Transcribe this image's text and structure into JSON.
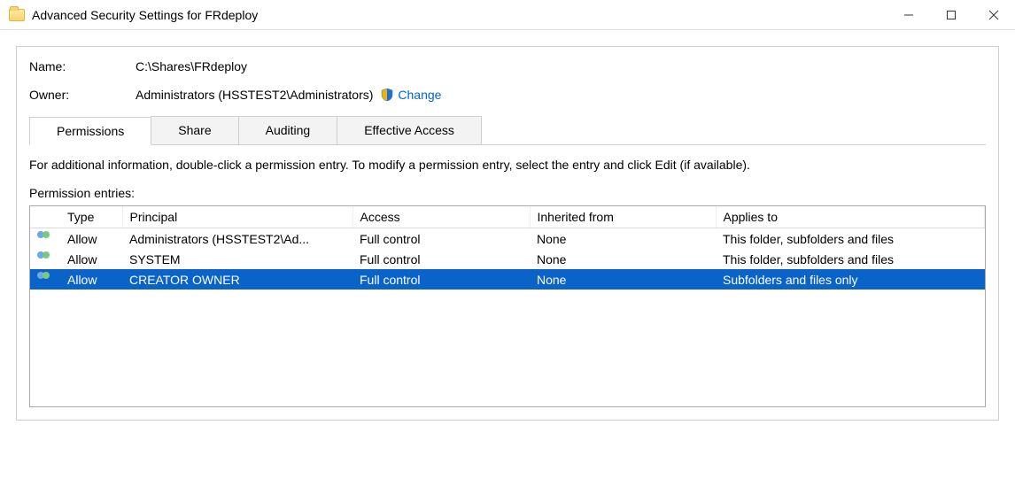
{
  "window": {
    "title": "Advanced Security Settings for FRdeploy"
  },
  "fields": {
    "name_label": "Name:",
    "name_value": "C:\\Shares\\FRdeploy",
    "owner_label": "Owner:",
    "owner_value": "Administrators (HSSTEST2\\Administrators)",
    "change_link": "Change"
  },
  "tabs": {
    "permissions": "Permissions",
    "share": "Share",
    "auditing": "Auditing",
    "effective": "Effective Access",
    "active": "permissions"
  },
  "permissions_tab": {
    "info": "For additional information, double-click a permission entry. To modify a permission entry, select the entry and click Edit (if available).",
    "entries_label": "Permission entries:",
    "columns": {
      "type": "Type",
      "principal": "Principal",
      "access": "Access",
      "inherited": "Inherited from",
      "applies": "Applies to"
    },
    "rows": [
      {
        "type": "Allow",
        "principal": "Administrators (HSSTEST2\\Ad...",
        "access": "Full control",
        "inherited": "None",
        "applies": "This folder, subfolders and files",
        "selected": false
      },
      {
        "type": "Allow",
        "principal": "SYSTEM",
        "access": "Full control",
        "inherited": "None",
        "applies": "This folder, subfolders and files",
        "selected": false
      },
      {
        "type": "Allow",
        "principal": "CREATOR OWNER",
        "access": "Full control",
        "inherited": "None",
        "applies": "Subfolders and files only",
        "selected": true
      }
    ]
  }
}
